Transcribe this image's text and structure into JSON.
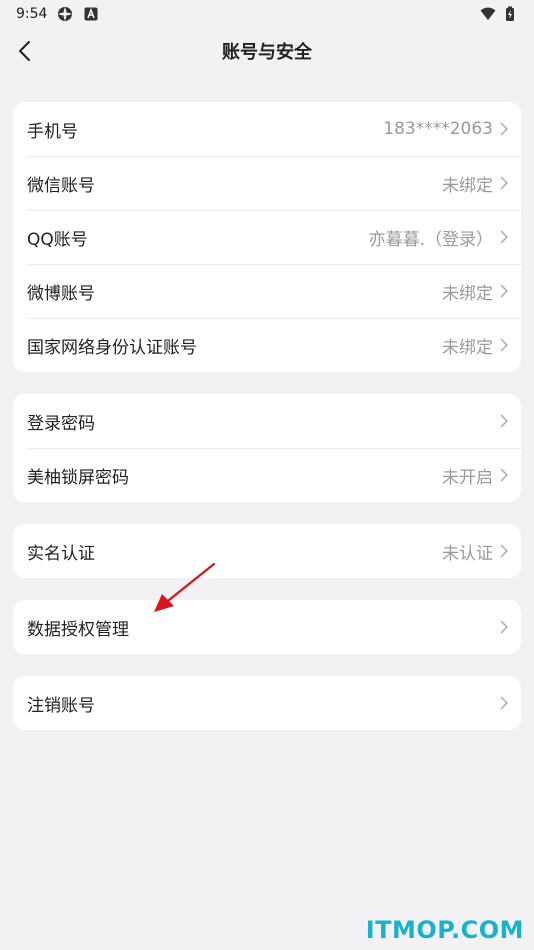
{
  "status_bar": {
    "time": "9:54",
    "icons": [
      "wheel-icon",
      "font-a-icon",
      "wifi-icon",
      "battery-icon"
    ]
  },
  "header": {
    "title": "账号与安全",
    "back_icon": "chevron-left-icon"
  },
  "groups": [
    {
      "rows": [
        {
          "label": "手机号",
          "value": "183****2063"
        },
        {
          "label": "微信账号",
          "value": "未绑定"
        },
        {
          "label": "QQ账号",
          "value": "亦暮暮.（登录）"
        },
        {
          "label": "微博账号",
          "value": "未绑定"
        },
        {
          "label": "国家网络身份认证账号",
          "value": "未绑定"
        }
      ]
    },
    {
      "rows": [
        {
          "label": "登录密码",
          "value": ""
        },
        {
          "label": "美柚锁屏密码",
          "value": "未开启"
        }
      ]
    },
    {
      "rows": [
        {
          "label": "实名认证",
          "value": "未认证"
        }
      ]
    },
    {
      "rows": [
        {
          "label": "数据授权管理",
          "value": ""
        }
      ]
    },
    {
      "rows": [
        {
          "label": "注销账号",
          "value": ""
        }
      ]
    }
  ],
  "watermark": "ITMOP.COM",
  "colors": {
    "background": "#f2f2f4",
    "card": "#ffffff",
    "secondary_text": "#9a9a9a",
    "watermark": "#19b3c9",
    "annotation_arrow": "#d9151c"
  }
}
